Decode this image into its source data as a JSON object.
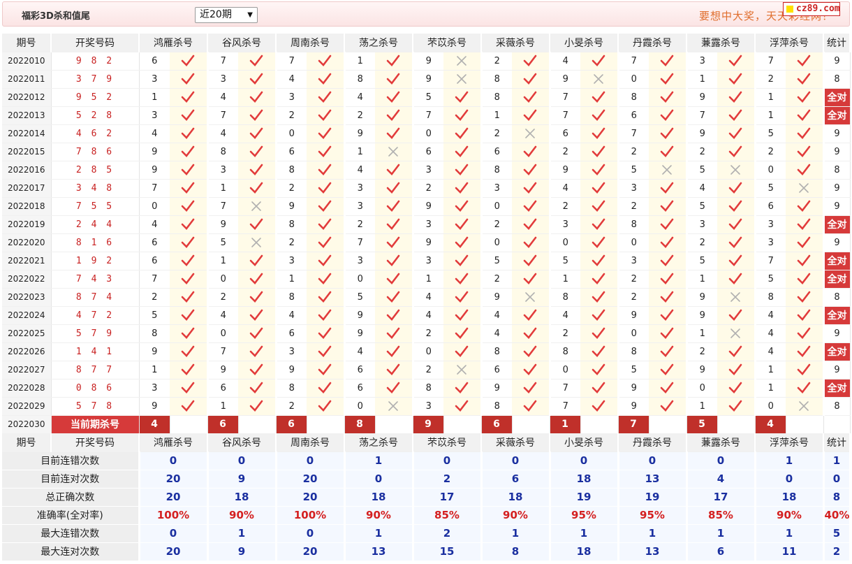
{
  "header": {
    "title": "福彩3D杀和值尾",
    "range_select": "近20期",
    "slogan": "要想中大奖，天天彩经网！",
    "logo_text": "cz89.com"
  },
  "columns": {
    "issue": "期号",
    "draw": "开奖号码",
    "experts": [
      "鸿雁杀号",
      "谷风杀号",
      "周南杀号",
      "荡之杀号",
      "芣苡杀号",
      "采薇杀号",
      "小旻杀号",
      "丹霞杀号",
      "蒹露杀号",
      "浮萍杀号"
    ],
    "stat": "统计"
  },
  "rows": [
    {
      "issue": "2022010",
      "draw": "9 8 2",
      "kills": [
        6,
        7,
        7,
        1,
        9,
        2,
        4,
        7,
        3,
        7
      ],
      "ok": [
        1,
        1,
        1,
        1,
        0,
        1,
        1,
        1,
        1,
        1
      ],
      "stat": "9"
    },
    {
      "issue": "2022011",
      "draw": "3 7 9",
      "kills": [
        3,
        3,
        4,
        8,
        9,
        8,
        9,
        0,
        1,
        2
      ],
      "ok": [
        1,
        1,
        1,
        1,
        0,
        1,
        0,
        1,
        1,
        1
      ],
      "stat": "8"
    },
    {
      "issue": "2022012",
      "draw": "9 5 2",
      "kills": [
        1,
        4,
        3,
        4,
        5,
        8,
        7,
        8,
        9,
        1
      ],
      "ok": [
        1,
        1,
        1,
        1,
        1,
        1,
        1,
        1,
        1,
        1
      ],
      "stat": "全对"
    },
    {
      "issue": "2022013",
      "draw": "5 2 8",
      "kills": [
        3,
        7,
        2,
        2,
        7,
        1,
        7,
        6,
        7,
        1
      ],
      "ok": [
        1,
        1,
        1,
        1,
        1,
        1,
        1,
        1,
        1,
        1
      ],
      "stat": "全对"
    },
    {
      "issue": "2022014",
      "draw": "4 6 2",
      "kills": [
        4,
        4,
        0,
        9,
        0,
        2,
        6,
        7,
        9,
        5
      ],
      "ok": [
        1,
        1,
        1,
        1,
        1,
        0,
        1,
        1,
        1,
        1
      ],
      "stat": "9"
    },
    {
      "issue": "2022015",
      "draw": "7 8 6",
      "kills": [
        9,
        8,
        6,
        1,
        6,
        6,
        2,
        2,
        2,
        2
      ],
      "ok": [
        1,
        1,
        1,
        0,
        1,
        1,
        1,
        1,
        1,
        1
      ],
      "stat": "9"
    },
    {
      "issue": "2022016",
      "draw": "2 8 5",
      "kills": [
        9,
        3,
        8,
        4,
        3,
        8,
        9,
        5,
        5,
        0
      ],
      "ok": [
        1,
        1,
        1,
        1,
        1,
        1,
        1,
        0,
        0,
        1
      ],
      "stat": "8"
    },
    {
      "issue": "2022017",
      "draw": "3 4 8",
      "kills": [
        7,
        1,
        2,
        3,
        2,
        3,
        4,
        3,
        4,
        5
      ],
      "ok": [
        1,
        1,
        1,
        1,
        1,
        1,
        1,
        1,
        1,
        0
      ],
      "stat": "9"
    },
    {
      "issue": "2022018",
      "draw": "7 5 5",
      "kills": [
        0,
        7,
        9,
        3,
        9,
        0,
        2,
        2,
        5,
        6
      ],
      "ok": [
        1,
        0,
        1,
        1,
        1,
        1,
        1,
        1,
        1,
        1
      ],
      "stat": "9"
    },
    {
      "issue": "2022019",
      "draw": "2 4 4",
      "kills": [
        4,
        9,
        8,
        2,
        3,
        2,
        3,
        8,
        3,
        3
      ],
      "ok": [
        1,
        1,
        1,
        1,
        1,
        1,
        1,
        1,
        1,
        1
      ],
      "stat": "全对"
    },
    {
      "issue": "2022020",
      "draw": "8 1 6",
      "kills": [
        6,
        5,
        2,
        7,
        9,
        0,
        0,
        0,
        2,
        3
      ],
      "ok": [
        1,
        0,
        1,
        1,
        1,
        1,
        1,
        1,
        1,
        1
      ],
      "stat": "9"
    },
    {
      "issue": "2022021",
      "draw": "1 9 2",
      "kills": [
        6,
        1,
        3,
        3,
        3,
        5,
        5,
        3,
        5,
        7
      ],
      "ok": [
        1,
        1,
        1,
        1,
        1,
        1,
        1,
        1,
        1,
        1
      ],
      "stat": "全对"
    },
    {
      "issue": "2022022",
      "draw": "7 4 3",
      "kills": [
        7,
        0,
        1,
        0,
        1,
        2,
        1,
        2,
        1,
        5
      ],
      "ok": [
        1,
        1,
        1,
        1,
        1,
        1,
        1,
        1,
        1,
        1
      ],
      "stat": "全对"
    },
    {
      "issue": "2022023",
      "draw": "8 7 4",
      "kills": [
        2,
        2,
        8,
        5,
        4,
        9,
        8,
        2,
        9,
        8
      ],
      "ok": [
        1,
        1,
        1,
        1,
        1,
        0,
        1,
        1,
        0,
        1
      ],
      "stat": "8"
    },
    {
      "issue": "2022024",
      "draw": "4 7 2",
      "kills": [
        5,
        4,
        4,
        9,
        4,
        4,
        4,
        9,
        9,
        4
      ],
      "ok": [
        1,
        1,
        1,
        1,
        1,
        1,
        1,
        1,
        1,
        1
      ],
      "stat": "全对"
    },
    {
      "issue": "2022025",
      "draw": "5 7 9",
      "kills": [
        8,
        0,
        6,
        9,
        2,
        4,
        2,
        0,
        1,
        4
      ],
      "ok": [
        1,
        1,
        1,
        1,
        1,
        1,
        1,
        1,
        0,
        1
      ],
      "stat": "9"
    },
    {
      "issue": "2022026",
      "draw": "1 4 1",
      "kills": [
        9,
        7,
        3,
        4,
        0,
        8,
        8,
        8,
        2,
        4
      ],
      "ok": [
        1,
        1,
        1,
        1,
        1,
        1,
        1,
        1,
        1,
        1
      ],
      "stat": "全对"
    },
    {
      "issue": "2022027",
      "draw": "8 7 7",
      "kills": [
        1,
        9,
        9,
        6,
        2,
        6,
        0,
        5,
        9,
        1
      ],
      "ok": [
        1,
        1,
        1,
        1,
        0,
        1,
        1,
        1,
        1,
        1
      ],
      "stat": "9"
    },
    {
      "issue": "2022028",
      "draw": "0 8 6",
      "kills": [
        3,
        6,
        8,
        6,
        8,
        9,
        7,
        9,
        0,
        1
      ],
      "ok": [
        1,
        1,
        1,
        1,
        1,
        1,
        1,
        1,
        1,
        1
      ],
      "stat": "全对"
    },
    {
      "issue": "2022029",
      "draw": "5 7 8",
      "kills": [
        9,
        1,
        2,
        0,
        3,
        8,
        7,
        9,
        1,
        0
      ],
      "ok": [
        1,
        1,
        1,
        0,
        1,
        1,
        1,
        1,
        1,
        0
      ],
      "stat": "8"
    }
  ],
  "current": {
    "issue": "2022030",
    "label": "当前期杀号",
    "kills": [
      "4",
      "6",
      "6",
      "8",
      "9",
      "6",
      "1",
      "7",
      "5",
      "4"
    ]
  },
  "summary": [
    {
      "label": "目前连错次数",
      "values": [
        "0",
        "0",
        "0",
        "1",
        "0",
        "0",
        "0",
        "0",
        "0",
        "1",
        "1"
      ]
    },
    {
      "label": "目前连对次数",
      "values": [
        "20",
        "9",
        "20",
        "0",
        "2",
        "6",
        "18",
        "13",
        "4",
        "0",
        "0"
      ]
    },
    {
      "label": "总正确次数",
      "values": [
        "20",
        "18",
        "20",
        "18",
        "17",
        "18",
        "19",
        "19",
        "17",
        "18",
        "8"
      ]
    },
    {
      "label": "准确率(全对率)",
      "values": [
        "100%",
        "90%",
        "100%",
        "90%",
        "85%",
        "90%",
        "95%",
        "95%",
        "85%",
        "90%",
        "40%"
      ],
      "pct": true
    },
    {
      "label": "最大连错次数",
      "values": [
        "0",
        "1",
        "0",
        "1",
        "2",
        "1",
        "1",
        "1",
        "1",
        "1",
        "5"
      ]
    },
    {
      "label": "最大连对次数",
      "values": [
        "20",
        "9",
        "20",
        "13",
        "15",
        "8",
        "18",
        "13",
        "6",
        "11",
        "2"
      ]
    }
  ],
  "colors": {
    "accent_red": "#d63a3a",
    "check_red": "#e23b3b",
    "cross_gray": "#b0b0b0",
    "value_blue": "#1a2fa0",
    "slogan_orange": "#e06e2d"
  }
}
